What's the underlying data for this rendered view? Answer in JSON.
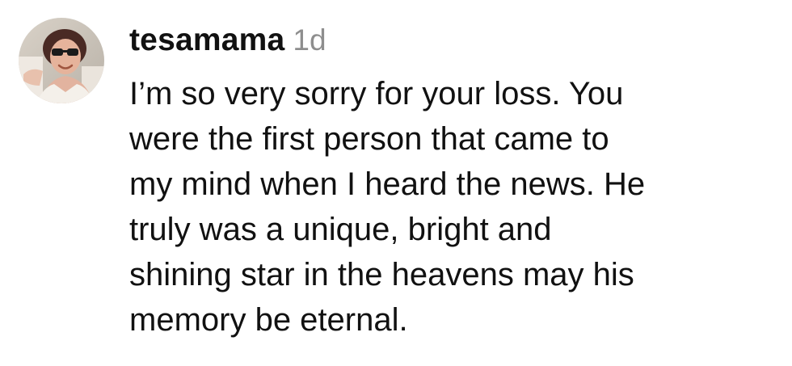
{
  "comment": {
    "username": "tesamama",
    "timestamp": "1d",
    "avatar_icon": "user-avatar-photo",
    "text_lines": [
      "I’m so very sorry for your loss. You",
      "were the first person that came to",
      "my mind when I heard the news. He",
      "truly was a unique, bright and",
      "shining star in the heavens may his",
      "memory be eternal."
    ]
  },
  "colors": {
    "text": "#111111",
    "muted": "#8e8e8e",
    "background": "#ffffff"
  }
}
